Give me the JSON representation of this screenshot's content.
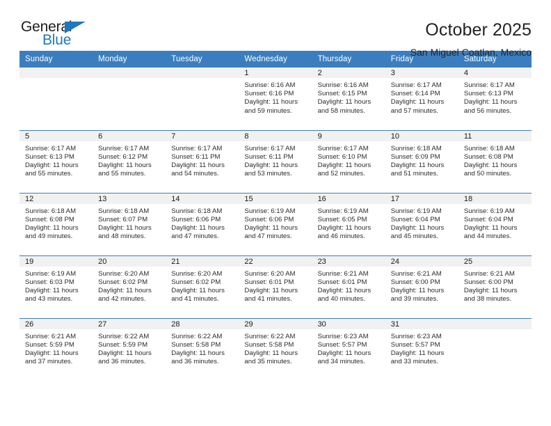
{
  "brand": {
    "name_part1": "General",
    "name_part2": "Blue",
    "logo_icon": "triangle-logo-icon",
    "accent_color": "#2077c4"
  },
  "header": {
    "title": "October 2025",
    "subtitle": "San Miguel Coatlan, Mexico"
  },
  "calendar": {
    "header_color": "#3a7ebf",
    "daynum_strip_color": "#f1f1f1",
    "weekday_headers": [
      "Sunday",
      "Monday",
      "Tuesday",
      "Wednesday",
      "Thursday",
      "Friday",
      "Saturday"
    ],
    "weeks": [
      [
        {
          "day": "",
          "lines": []
        },
        {
          "day": "",
          "lines": []
        },
        {
          "day": "",
          "lines": []
        },
        {
          "day": "1",
          "lines": [
            "Sunrise: 6:16 AM",
            "Sunset: 6:16 PM",
            "Daylight: 11 hours and 59 minutes."
          ]
        },
        {
          "day": "2",
          "lines": [
            "Sunrise: 6:16 AM",
            "Sunset: 6:15 PM",
            "Daylight: 11 hours and 58 minutes."
          ]
        },
        {
          "day": "3",
          "lines": [
            "Sunrise: 6:17 AM",
            "Sunset: 6:14 PM",
            "Daylight: 11 hours and 57 minutes."
          ]
        },
        {
          "day": "4",
          "lines": [
            "Sunrise: 6:17 AM",
            "Sunset: 6:13 PM",
            "Daylight: 11 hours and 56 minutes."
          ]
        }
      ],
      [
        {
          "day": "5",
          "lines": [
            "Sunrise: 6:17 AM",
            "Sunset: 6:13 PM",
            "Daylight: 11 hours and 55 minutes."
          ]
        },
        {
          "day": "6",
          "lines": [
            "Sunrise: 6:17 AM",
            "Sunset: 6:12 PM",
            "Daylight: 11 hours and 55 minutes."
          ]
        },
        {
          "day": "7",
          "lines": [
            "Sunrise: 6:17 AM",
            "Sunset: 6:11 PM",
            "Daylight: 11 hours and 54 minutes."
          ]
        },
        {
          "day": "8",
          "lines": [
            "Sunrise: 6:17 AM",
            "Sunset: 6:11 PM",
            "Daylight: 11 hours and 53 minutes."
          ]
        },
        {
          "day": "9",
          "lines": [
            "Sunrise: 6:17 AM",
            "Sunset: 6:10 PM",
            "Daylight: 11 hours and 52 minutes."
          ]
        },
        {
          "day": "10",
          "lines": [
            "Sunrise: 6:18 AM",
            "Sunset: 6:09 PM",
            "Daylight: 11 hours and 51 minutes."
          ]
        },
        {
          "day": "11",
          "lines": [
            "Sunrise: 6:18 AM",
            "Sunset: 6:08 PM",
            "Daylight: 11 hours and 50 minutes."
          ]
        }
      ],
      [
        {
          "day": "12",
          "lines": [
            "Sunrise: 6:18 AM",
            "Sunset: 6:08 PM",
            "Daylight: 11 hours and 49 minutes."
          ]
        },
        {
          "day": "13",
          "lines": [
            "Sunrise: 6:18 AM",
            "Sunset: 6:07 PM",
            "Daylight: 11 hours and 48 minutes."
          ]
        },
        {
          "day": "14",
          "lines": [
            "Sunrise: 6:18 AM",
            "Sunset: 6:06 PM",
            "Daylight: 11 hours and 47 minutes."
          ]
        },
        {
          "day": "15",
          "lines": [
            "Sunrise: 6:19 AM",
            "Sunset: 6:06 PM",
            "Daylight: 11 hours and 47 minutes."
          ]
        },
        {
          "day": "16",
          "lines": [
            "Sunrise: 6:19 AM",
            "Sunset: 6:05 PM",
            "Daylight: 11 hours and 46 minutes."
          ]
        },
        {
          "day": "17",
          "lines": [
            "Sunrise: 6:19 AM",
            "Sunset: 6:04 PM",
            "Daylight: 11 hours and 45 minutes."
          ]
        },
        {
          "day": "18",
          "lines": [
            "Sunrise: 6:19 AM",
            "Sunset: 6:04 PM",
            "Daylight: 11 hours and 44 minutes."
          ]
        }
      ],
      [
        {
          "day": "19",
          "lines": [
            "Sunrise: 6:19 AM",
            "Sunset: 6:03 PM",
            "Daylight: 11 hours and 43 minutes."
          ]
        },
        {
          "day": "20",
          "lines": [
            "Sunrise: 6:20 AM",
            "Sunset: 6:02 PM",
            "Daylight: 11 hours and 42 minutes."
          ]
        },
        {
          "day": "21",
          "lines": [
            "Sunrise: 6:20 AM",
            "Sunset: 6:02 PM",
            "Daylight: 11 hours and 41 minutes."
          ]
        },
        {
          "day": "22",
          "lines": [
            "Sunrise: 6:20 AM",
            "Sunset: 6:01 PM",
            "Daylight: 11 hours and 41 minutes."
          ]
        },
        {
          "day": "23",
          "lines": [
            "Sunrise: 6:21 AM",
            "Sunset: 6:01 PM",
            "Daylight: 11 hours and 40 minutes."
          ]
        },
        {
          "day": "24",
          "lines": [
            "Sunrise: 6:21 AM",
            "Sunset: 6:00 PM",
            "Daylight: 11 hours and 39 minutes."
          ]
        },
        {
          "day": "25",
          "lines": [
            "Sunrise: 6:21 AM",
            "Sunset: 6:00 PM",
            "Daylight: 11 hours and 38 minutes."
          ]
        }
      ],
      [
        {
          "day": "26",
          "lines": [
            "Sunrise: 6:21 AM",
            "Sunset: 5:59 PM",
            "Daylight: 11 hours and 37 minutes."
          ]
        },
        {
          "day": "27",
          "lines": [
            "Sunrise: 6:22 AM",
            "Sunset: 5:59 PM",
            "Daylight: 11 hours and 36 minutes."
          ]
        },
        {
          "day": "28",
          "lines": [
            "Sunrise: 6:22 AM",
            "Sunset: 5:58 PM",
            "Daylight: 11 hours and 36 minutes."
          ]
        },
        {
          "day": "29",
          "lines": [
            "Sunrise: 6:22 AM",
            "Sunset: 5:58 PM",
            "Daylight: 11 hours and 35 minutes."
          ]
        },
        {
          "day": "30",
          "lines": [
            "Sunrise: 6:23 AM",
            "Sunset: 5:57 PM",
            "Daylight: 11 hours and 34 minutes."
          ]
        },
        {
          "day": "31",
          "lines": [
            "Sunrise: 6:23 AM",
            "Sunset: 5:57 PM",
            "Daylight: 11 hours and 33 minutes."
          ]
        },
        {
          "day": "",
          "lines": []
        }
      ]
    ]
  }
}
